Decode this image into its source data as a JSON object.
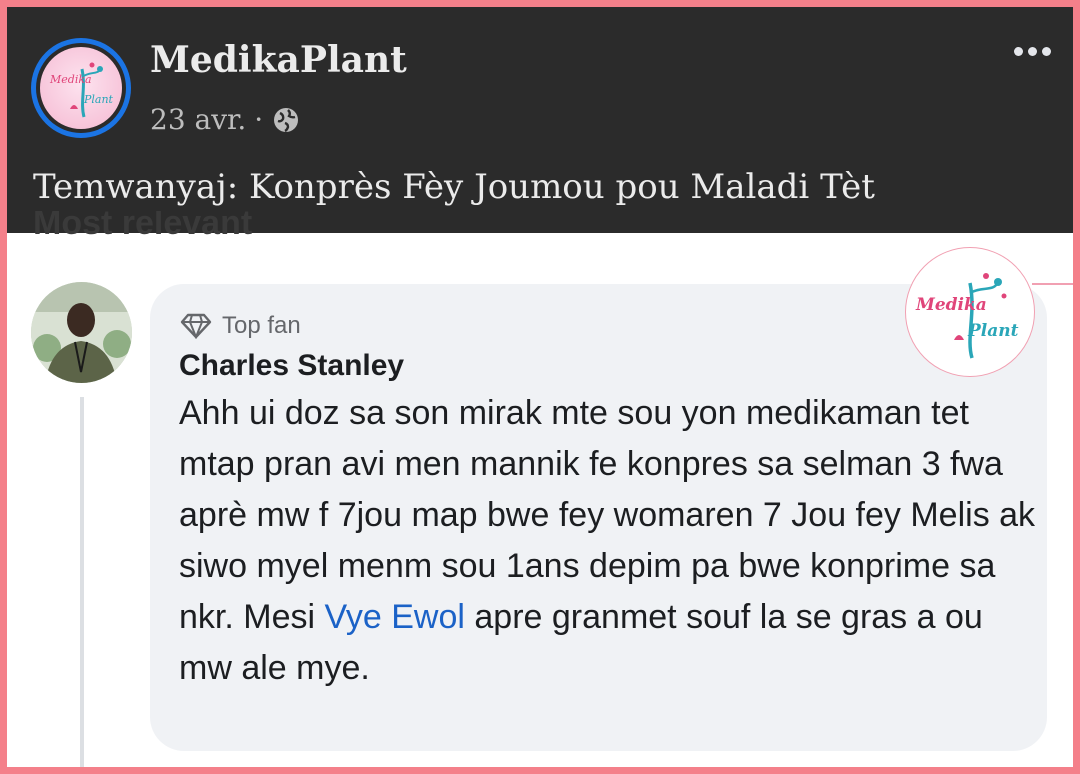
{
  "post": {
    "page_name": "MedikaPlant",
    "date": "23 avr.",
    "separator": "·",
    "title": "Temwanyaj: Konprès Fèy Joumou pou Maladi Tèt",
    "cutoff_text": "Most relevant"
  },
  "logo": {
    "text_top": "Medika",
    "text_bottom": "Plant",
    "brand_pink": "#e0457a",
    "brand_teal": "#2aa6b8"
  },
  "comment": {
    "badge": "Top fan",
    "author": "Charles Stanley",
    "text_before": "Ahh ui doz sa son mirak mte sou yon medikaman tet mtap pran avi men mannik fe konpres sa selman 3 fwa aprè mw f 7jou map bwe fey womaren 7 Jou fey Melis ak siwo myel menm sou 1ans depim pa bwe konprime sa nkr. Mesi ",
    "mention": "Vye Ewol",
    "text_after": " apre granmet souf la se gras a ou mw ale mye."
  },
  "icons": {
    "globe": "globe-icon",
    "more": "more-options-icon",
    "diamond": "diamond-icon"
  }
}
